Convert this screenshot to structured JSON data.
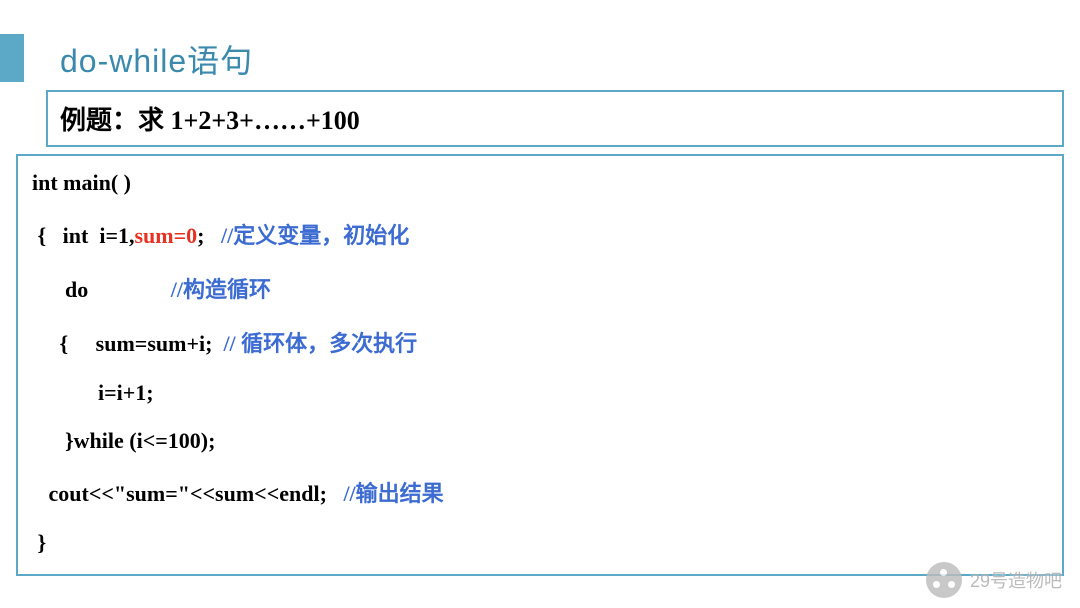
{
  "title": "do-while语句",
  "problem": "例题：求 1+2+3+……+100",
  "code": {
    "l1": "int main( )",
    "l2a": " {   int  i=1,",
    "l2b": "sum=0",
    "l2c": ";   ",
    "l2d": "//定义变量，初始化",
    "l3a": "      do               ",
    "l3b": "//构造循环",
    "l4a": "     {     sum=sum+i;  ",
    "l4b": "// 循环体，多次执行",
    "l5": "            i=i+1;",
    "l6": "      }while (i<=100);",
    "l7a": "   cout<<\"sum=\"<<sum<<endl;   ",
    "l7b": "//输出结果",
    "l8": " }"
  },
  "watermark": "29号造物吧"
}
